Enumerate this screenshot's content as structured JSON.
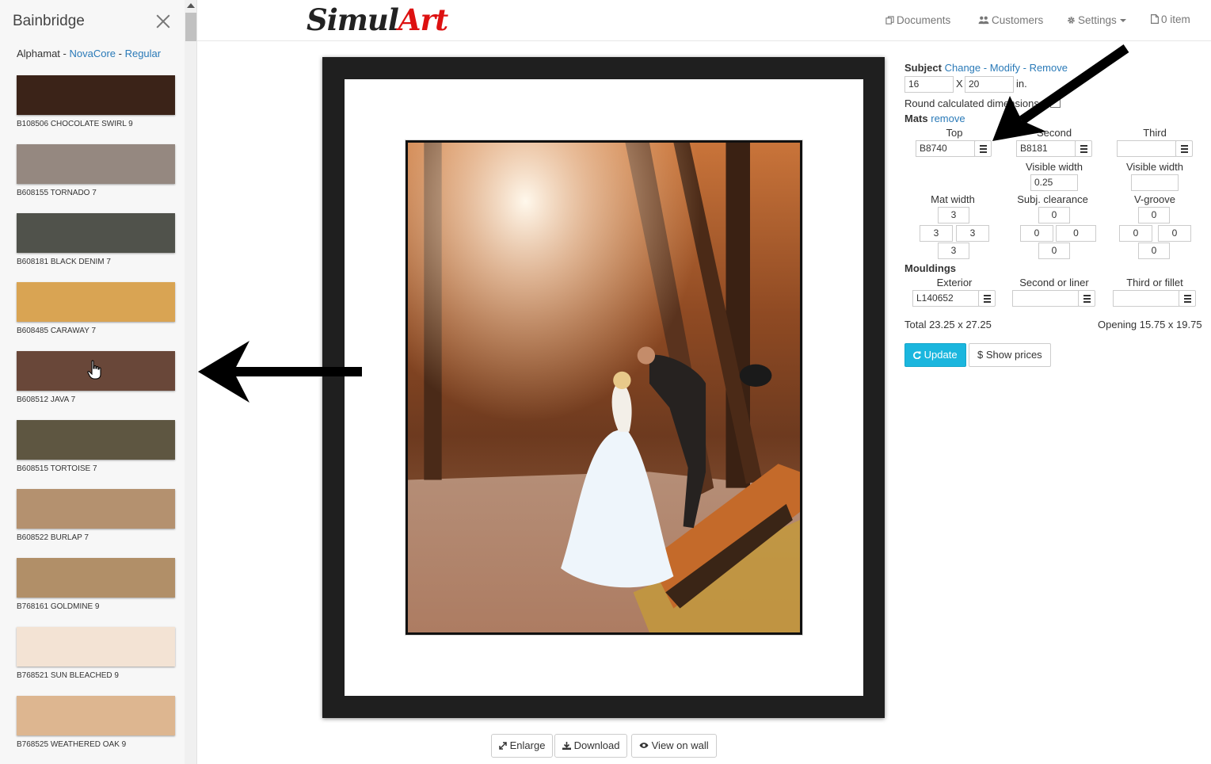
{
  "sidebar": {
    "title": "Bainbridge",
    "breadcrumb": {
      "brand": "Alphamat",
      "sep1": " - ",
      "collection": "NovaCore",
      "sep2": " - ",
      "type": "Regular"
    },
    "swatches": [
      {
        "label": "B108506 CHOCOLATE SWIRL  9",
        "color": "#3b2318"
      },
      {
        "label": "B608155 TORNADO  7",
        "color": "#958880"
      },
      {
        "label": "B608181 BLACK DENIM  7",
        "color": "#50524b"
      },
      {
        "label": "B608485 CARAWAY  7",
        "color": "#d9a453"
      },
      {
        "label": "B608512 JAVA  7",
        "color": "#694739"
      },
      {
        "label": "B608515 TORTOISE  7",
        "color": "#5e5641"
      },
      {
        "label": "B608522 BURLAP  7",
        "color": "#b4916f"
      },
      {
        "label": "B768161 GOLDMINE  9",
        "color": "#b18f68"
      },
      {
        "label": "B768521 SUN BLEACHED  9",
        "color": "#f3e3d4"
      },
      {
        "label": "B768525 WEATHERED OAK  9",
        "color": "#ddb690"
      }
    ]
  },
  "nav": {
    "logo_part1": "Simul",
    "logo_part2": "Art",
    "documents": "Documents",
    "customers": "Customers",
    "settings": "Settings",
    "cart": "0 item"
  },
  "preview_actions": {
    "enlarge": "Enlarge",
    "download": "Download",
    "view_on_wall": "View on wall"
  },
  "panel": {
    "subject_label": "Subject",
    "change": "Change",
    "modify": "Modify",
    "remove": "Remove",
    "dash": " - ",
    "width": "16",
    "x": "X",
    "height": "20",
    "unit": "in.",
    "round_label": "Round calculated dimensions",
    "mats_label": "Mats",
    "mats_remove": "remove",
    "col_top": "Top",
    "col_second": "Second",
    "col_third": "Third",
    "top_mat": "B8740",
    "second_mat": "B8181",
    "third_mat": "",
    "visible_width_label": "Visible width",
    "second_visible_width": "0.25",
    "third_visible_width": "",
    "mat_width_label": "Mat width",
    "subj_clearance_label": "Subj. clearance",
    "vgroove_label": "V-groove",
    "mat_width": {
      "top": "3",
      "left": "3",
      "right": "3",
      "bottom": "3"
    },
    "clearance": {
      "top": "0",
      "left": "0",
      "right": "0",
      "bottom": "0"
    },
    "vgroove": {
      "top": "0",
      "left": "0",
      "right": "0",
      "bottom": "0"
    },
    "mouldings_label": "Mouldings",
    "exterior_label": "Exterior",
    "second_liner_label": "Second or liner",
    "third_fillet_label": "Third or fillet",
    "exterior": "L140652",
    "second_liner": "",
    "third_fillet": "",
    "total": "Total 23.25 x 27.25",
    "opening": "Opening 15.75 x 19.75",
    "update": "Update",
    "show_prices": "Show prices"
  }
}
